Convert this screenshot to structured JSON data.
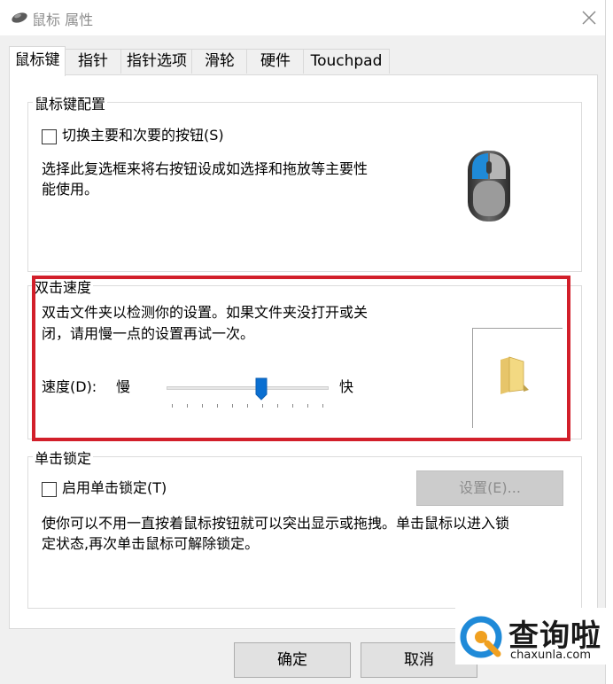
{
  "window": {
    "title": "鼠标 属性"
  },
  "tabs": [
    {
      "label": "鼠标键"
    },
    {
      "label": "指针"
    },
    {
      "label": "指针选项"
    },
    {
      "label": "滑轮"
    },
    {
      "label": "硬件"
    },
    {
      "label": "Touchpad"
    }
  ],
  "button_config": {
    "title": "鼠标键配置",
    "checkbox_label": "切换主要和次要的按钮(S)",
    "description_line1": "选择此复选框来将右按钮设成如选择和拖放等主要性",
    "description_line2": "能使用。"
  },
  "double_click": {
    "title": "双击速度",
    "description_line1": "双击文件夹以检测你的设置。如果文件夹没打开或关",
    "description_line2": "闭，请用慢一点的设置再试一次。",
    "speed_label": "速度(D):",
    "slow_label": "慢",
    "fast_label": "快",
    "speed_value": 0.6
  },
  "click_lock": {
    "title": "单击锁定",
    "checkbox_label": "启用单击锁定(T)",
    "settings_button": "设置(E)...",
    "description_line1": "使你可以不用一直按着鼠标按钮就可以突出显示或拖拽。单击鼠标以进入锁",
    "description_line2": "定状态,再次单击鼠标可解除锁定。"
  },
  "footer": {
    "ok_label": "确定",
    "cancel_label": "取消"
  },
  "watermark": {
    "brand": "查询啦",
    "url": "chaxunla.com"
  },
  "colors": {
    "highlight": "#d21f2a",
    "accent_blue": "#1f8ad8"
  },
  "icons": {
    "title": "mouse-icon",
    "close": "close-icon",
    "mouse_image": "mouse-image",
    "folder": "folder-icon"
  }
}
